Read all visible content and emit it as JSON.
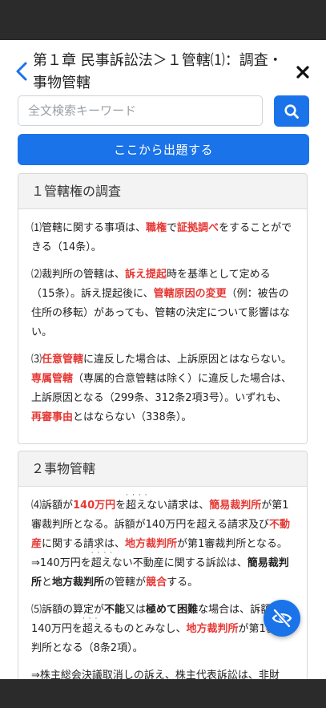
{
  "header": {
    "title": "第１章 民事訴訟法＞１管轄⑴：調査・事物管轄"
  },
  "search": {
    "placeholder": "全文検索キーワード"
  },
  "start_button": "ここから出題する",
  "sections": [
    {
      "title": "１管轄権の調査",
      "paragraphs": [
        [
          {
            "t": "⑴管轄に関する事項は、"
          },
          {
            "t": "職権",
            "s": "red"
          },
          {
            "t": "で"
          },
          {
            "t": "証拠調べ",
            "s": "red"
          },
          {
            "t": "をすることができる（14条）。"
          }
        ],
        [
          {
            "t": "⑵裁判所の管轄は、"
          },
          {
            "t": "訴え提起",
            "s": "red"
          },
          {
            "t": "時を基準として定める（15条）。訴え提起後に、"
          },
          {
            "t": "管轄原因の変更",
            "s": "red"
          },
          {
            "t": "（例：被告の住所の移転）があっても、管轄の決定について影響はない。"
          }
        ],
        [
          {
            "t": "⑶"
          },
          {
            "t": "任意管轄",
            "s": "red"
          },
          {
            "t": "に違反した場合は、上訴原因とはならない。"
          },
          {
            "t": "専属管轄",
            "s": "red"
          },
          {
            "t": "（専属的合意管轄は除く）に違反した場合は、上訴原因となる（299条、312条2項3号）。いずれも、"
          },
          {
            "t": "再審事由",
            "s": "red"
          },
          {
            "t": "とはならない（338条）。"
          }
        ]
      ]
    },
    {
      "title": "２事物管轄",
      "paragraphs": [
        [
          {
            "t": "⑷訴額が"
          },
          {
            "t": "140万円",
            "s": "red"
          },
          {
            "t": "を"
          },
          {
            "t": "超えない",
            "s": "dots"
          },
          {
            "t": "請求は、"
          },
          {
            "t": "簡易裁判所",
            "s": "red"
          },
          {
            "t": "が第1審裁判所となる。訴額が140万円を超える請求及び"
          },
          {
            "t": "不動産",
            "s": "red"
          },
          {
            "t": "に関する請求は、"
          },
          {
            "t": "地方裁判所",
            "s": "red"
          },
          {
            "t": "が第1審裁判所となる。⇒140万円を"
          },
          {
            "t": "超えない",
            "s": "dots"
          },
          {
            "t": "不動産に関する訴訟は、"
          },
          {
            "t": "簡易裁判所",
            "s": "bold"
          },
          {
            "t": "と"
          },
          {
            "t": "地方裁判所",
            "s": "bold"
          },
          {
            "t": "の管轄が"
          },
          {
            "t": "競合",
            "s": "red"
          },
          {
            "t": "する。"
          }
        ],
        [
          {
            "t": "⑸訴額の算定が"
          },
          {
            "t": "不能",
            "s": "bold"
          },
          {
            "t": "又は"
          },
          {
            "t": "極めて困難",
            "s": "bold"
          },
          {
            "t": "な場合は、訴額を140万円を"
          },
          {
            "t": "超える",
            "s": "dots"
          },
          {
            "t": "ものとみなし、"
          },
          {
            "t": "地方裁判所",
            "s": "red"
          },
          {
            "t": "が第1審裁判所となる（8条2項）。"
          }
        ],
        [
          {
            "t": "⇒株主総会決議取消しの訴え、株主代表訴訟は、非財"
          }
        ]
      ]
    }
  ]
}
